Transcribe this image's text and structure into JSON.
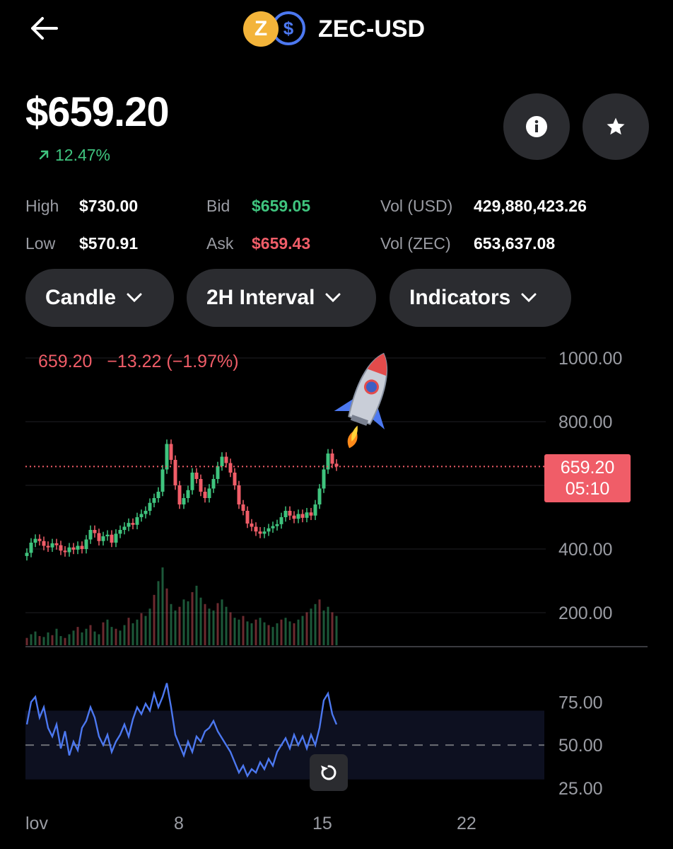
{
  "header": {
    "pair": "ZEC-USD",
    "back_icon": "arrow-left-icon",
    "coin_base": "Z",
    "coin_quote": "$"
  },
  "price": {
    "current": "$659.20",
    "change_pct": "12.47%",
    "change_color": "#3fc47e"
  },
  "stats": {
    "high_label": "High",
    "high": "$730.00",
    "low_label": "Low",
    "low": "$570.91",
    "bid_label": "Bid",
    "bid": "$659.05",
    "ask_label": "Ask",
    "ask": "$659.43",
    "vol_usd_label": "Vol (USD)",
    "vol_usd": "429,880,423.26",
    "vol_zec_label": "Vol (ZEC)",
    "vol_zec": "653,637.08"
  },
  "controls": {
    "chart_type": "Candle",
    "interval": "2H Interval",
    "indicators": "Indicators"
  },
  "colors": {
    "up": "#3fc47e",
    "down": "#f05d68",
    "accent": "#4c78f0",
    "panel": "#2b2c30"
  },
  "chart_data": [
    {
      "type": "candlestick",
      "ohlc_label": "659.20   −13.22 (−1.97%)",
      "last_price_tag": "659.20",
      "countdown": "05:10",
      "y_ticks": [
        "1000.00",
        "800.00",
        "400.00",
        "200.00"
      ],
      "ylim": [
        200,
        1000
      ],
      "x_ticks": [
        "lov",
        "8",
        "15",
        "22"
      ],
      "series": [
        {
          "values": [
            [
              1,
              388
            ],
            [
              2,
              420
            ],
            [
              3,
              432
            ],
            [
              4,
              425
            ],
            [
              5,
              410
            ],
            [
              6,
              405
            ],
            [
              7,
              418
            ],
            [
              8,
              412
            ],
            [
              9,
              395
            ],
            [
              10,
              390
            ],
            [
              11,
              405
            ],
            [
              12,
              398
            ],
            [
              13,
              410
            ],
            [
              14,
              400
            ],
            [
              15,
              430
            ],
            [
              16,
              460
            ],
            [
              17,
              450
            ],
            [
              18,
              425
            ],
            [
              19,
              440
            ],
            [
              20,
              445
            ],
            [
              21,
              420
            ],
            [
              22,
              448
            ],
            [
              23,
              460
            ],
            [
              24,
              470
            ],
            [
              25,
              482
            ],
            [
              26,
              476
            ],
            [
              27,
              500
            ],
            [
              28,
              510
            ],
            [
              29,
              520
            ],
            [
              30,
              545
            ],
            [
              31,
              560
            ],
            [
              32,
              580
            ],
            [
              33,
              650
            ],
            [
              34,
              730
            ],
            [
              35,
              680
            ],
            [
              36,
              600
            ],
            [
              37,
              540
            ],
            [
              38,
              560
            ],
            [
              39,
              585
            ],
            [
              40,
              640
            ],
            [
              41,
              620
            ],
            [
              42,
              580
            ],
            [
              43,
              560
            ],
            [
              44,
              590
            ],
            [
              45,
              620
            ],
            [
              46,
              660
            ],
            [
              47,
              690
            ],
            [
              48,
              670
            ],
            [
              49,
              640
            ],
            [
              50,
              600
            ],
            [
              51,
              540
            ],
            [
              52,
              520
            ],
            [
              53,
              480
            ],
            [
              54,
              470
            ],
            [
              55,
              455
            ],
            [
              56,
              448
            ],
            [
              57,
              455
            ],
            [
              58,
              465
            ],
            [
              59,
              472
            ],
            [
              60,
              478
            ],
            [
              61,
              500
            ],
            [
              62,
              520
            ],
            [
              63,
              505
            ],
            [
              64,
              495
            ],
            [
              65,
              510
            ],
            [
              66,
              498
            ],
            [
              67,
              515
            ],
            [
              68,
              505
            ],
            [
              69,
              540
            ],
            [
              70,
              590
            ],
            [
              71,
              650
            ],
            [
              72,
              700
            ],
            [
              73,
              668
            ],
            [
              74,
              659.2
            ]
          ]
        }
      ]
    },
    {
      "type": "bar",
      "title": "volume",
      "series": [
        {
          "values": [
            8,
            12,
            15,
            10,
            9,
            14,
            11,
            18,
            10,
            8,
            12,
            16,
            20,
            14,
            18,
            22,
            15,
            12,
            25,
            28,
            20,
            18,
            16,
            22,
            30,
            24,
            28,
            35,
            32,
            40,
            55,
            70,
            85,
            62,
            45,
            38,
            42,
            50,
            48,
            58,
            65,
            52,
            45,
            40,
            38,
            46,
            50,
            42,
            36,
            30,
            28,
            32,
            26,
            24,
            28,
            30,
            25,
            22,
            20,
            24,
            28,
            30,
            26,
            24,
            28,
            32,
            36,
            40,
            45,
            50,
            38,
            42,
            36,
            32
          ]
        }
      ]
    },
    {
      "type": "line",
      "title": "RSI",
      "y_ticks": [
        "75.00",
        "50.00",
        "25.00"
      ],
      "ylim": [
        20,
        85
      ],
      "series": [
        {
          "values": [
            [
              1,
              62
            ],
            [
              2,
              75
            ],
            [
              3,
              78
            ],
            [
              4,
              66
            ],
            [
              5,
              72
            ],
            [
              6,
              60
            ],
            [
              7,
              55
            ],
            [
              8,
              62
            ],
            [
              9,
              48
            ],
            [
              10,
              58
            ],
            [
              11,
              44
            ],
            [
              12,
              52
            ],
            [
              13,
              47
            ],
            [
              14,
              60
            ],
            [
              15,
              64
            ],
            [
              16,
              72
            ],
            [
              17,
              66
            ],
            [
              18,
              55
            ],
            [
              19,
              50
            ],
            [
              20,
              56
            ],
            [
              21,
              46
            ],
            [
              22,
              52
            ],
            [
              23,
              56
            ],
            [
              24,
              62
            ],
            [
              25,
              55
            ],
            [
              26,
              65
            ],
            [
              27,
              72
            ],
            [
              28,
              68
            ],
            [
              29,
              74
            ],
            [
              30,
              70
            ],
            [
              31,
              80
            ],
            [
              32,
              72
            ],
            [
              33,
              78
            ],
            [
              34,
              86
            ],
            [
              35,
              72
            ],
            [
              36,
              56
            ],
            [
              37,
              50
            ],
            [
              38,
              44
            ],
            [
              39,
              52
            ],
            [
              40,
              46
            ],
            [
              41,
              55
            ],
            [
              42,
              52
            ],
            [
              43,
              58
            ],
            [
              44,
              60
            ],
            [
              45,
              64
            ],
            [
              46,
              58
            ],
            [
              47,
              54
            ],
            [
              48,
              50
            ],
            [
              49,
              46
            ],
            [
              50,
              40
            ],
            [
              51,
              34
            ],
            [
              52,
              38
            ],
            [
              53,
              32
            ],
            [
              54,
              36
            ],
            [
              55,
              34
            ],
            [
              56,
              40
            ],
            [
              57,
              36
            ],
            [
              58,
              42
            ],
            [
              59,
              38
            ],
            [
              60,
              46
            ],
            [
              61,
              50
            ],
            [
              62,
              54
            ],
            [
              63,
              48
            ],
            [
              64,
              56
            ],
            [
              65,
              50
            ],
            [
              66,
              55
            ],
            [
              67,
              48
            ],
            [
              68,
              56
            ],
            [
              69,
              50
            ],
            [
              70,
              60
            ],
            [
              71,
              76
            ],
            [
              72,
              80
            ],
            [
              73,
              68
            ],
            [
              74,
              62
            ]
          ]
        }
      ]
    }
  ]
}
